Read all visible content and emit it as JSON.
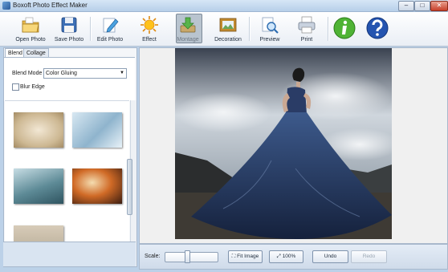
{
  "window": {
    "title": "Boxoft Photo Effect Maker",
    "controls": [
      "–",
      "□",
      "✕"
    ]
  },
  "toolbar": {
    "items": [
      {
        "label": "Open Photo",
        "icon": "folder-open-icon"
      },
      {
        "label": "Save Photo",
        "icon": "floppy-disk-icon"
      },
      {
        "label": "Edit Photo",
        "icon": "pencil-icon"
      },
      {
        "label": "Effect",
        "icon": "sun-icon"
      },
      {
        "label": "Montage",
        "icon": "download-tray-icon",
        "selected": true
      },
      {
        "label": "Decoration",
        "icon": "picture-frame-icon"
      },
      {
        "label": "Preview",
        "icon": "magnifier-icon"
      },
      {
        "label": "Print",
        "icon": "printer-icon"
      },
      {
        "label": "",
        "icon": "info-icon"
      },
      {
        "label": "",
        "icon": "help-icon"
      }
    ]
  },
  "left_panel": {
    "tabs": [
      "Blend",
      "Collage"
    ],
    "blend_mode_label": "Blend Mode",
    "blend_mode_value": "Color Gluing",
    "blur_edge_label": "Blur Edge",
    "blur_edge_checked": false
  },
  "bottom_bar": {
    "scale_label": "Scale:",
    "fit_image_label": "Fit Image",
    "zoom_100_label": "100%",
    "undo_label": "Undo",
    "redo_label": "Redo",
    "scale_level": 0.42
  },
  "colors": {
    "accent": "#3a6ea5",
    "background": "#bcd1e8"
  }
}
